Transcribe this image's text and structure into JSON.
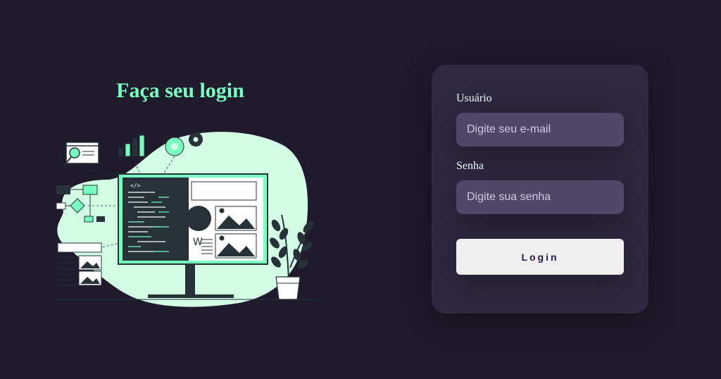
{
  "left_panel": {
    "title": "Faça seu login",
    "illustration": {
      "code_tag": "</>",
      "document_letter": "W",
      "colors": {
        "accent": "#77ffc0",
        "blob": "#d4fde6",
        "dark": "#263238"
      }
    }
  },
  "login_card": {
    "username": {
      "label": "Usuário",
      "placeholder": "Digite seu e-mail",
      "value": ""
    },
    "password": {
      "label": "Senha",
      "placeholder": "Digite sua senha",
      "value": ""
    },
    "submit_label": "Login"
  },
  "colors": {
    "background": "#201b2c",
    "card": "#2f2841",
    "input": "#514869",
    "title": "#77ffc0",
    "button": "#efefef",
    "button_text": "#2b134b"
  }
}
